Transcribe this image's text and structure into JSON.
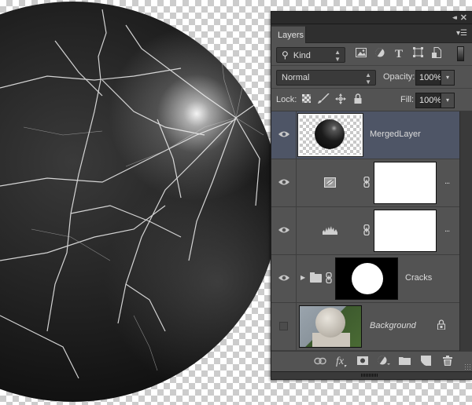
{
  "panel": {
    "tab_label": "Layers",
    "filter": {
      "kind_label": "Kind",
      "icons": [
        "pixel-filter-icon",
        "adjustment-filter-icon",
        "type-filter-icon",
        "shape-filter-icon",
        "smart-object-filter-icon"
      ]
    },
    "blend_mode": "Normal",
    "opacity_label": "Opacity:",
    "opacity_value": "100%",
    "lock_label": "Lock:",
    "fill_label": "Fill:",
    "fill_value": "100%"
  },
  "layers": [
    {
      "name": "MergedLayer",
      "visible": true,
      "selected": true,
      "type": "pixel"
    },
    {
      "name": "",
      "visible": true,
      "selected": false,
      "type": "hue-saturation-adjustment",
      "more": "..."
    },
    {
      "name": "",
      "visible": true,
      "selected": false,
      "type": "levels-adjustment",
      "more": "..."
    },
    {
      "name": "Cracks",
      "visible": true,
      "selected": false,
      "type": "group"
    },
    {
      "name": "Background",
      "visible": false,
      "selected": false,
      "type": "background",
      "locked": true
    }
  ],
  "glyphs": {
    "collapse": "◂◂",
    "close": "✕",
    "menu": "▾☰",
    "search": "⚲",
    "updown": "⬍",
    "dropdown": "▾",
    "more": "...",
    "expand": "▶",
    "chain": "⛓",
    "lock": "🔒"
  },
  "bottom_toolbar": [
    "link-layers",
    "add-layer-style",
    "add-mask",
    "new-fill-adjustment-layer",
    "new-group",
    "new-layer",
    "delete-layer"
  ]
}
